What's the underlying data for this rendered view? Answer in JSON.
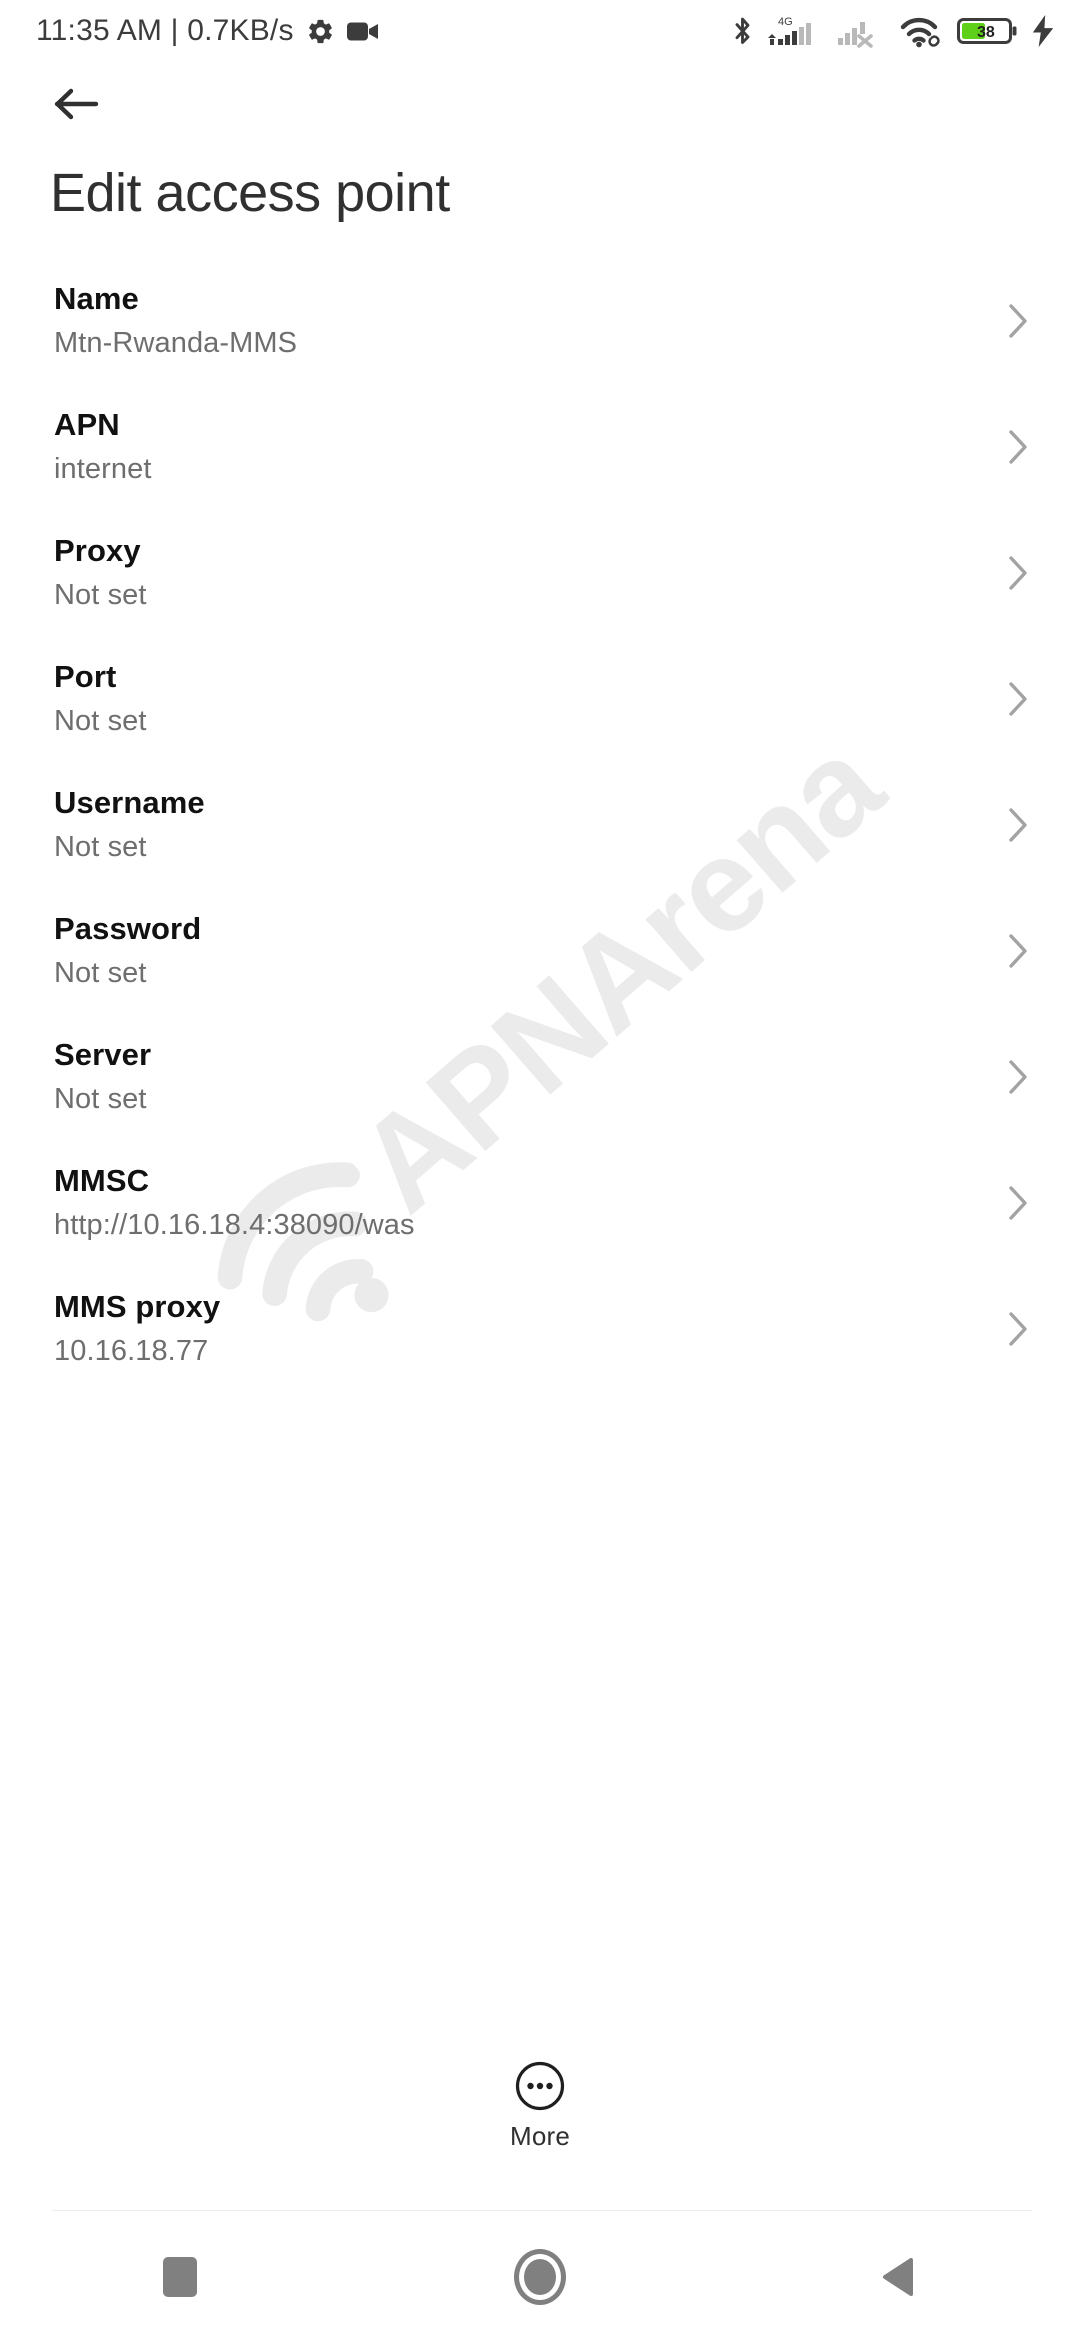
{
  "status_bar": {
    "clock_text": "11:35 AM | 0.7KB/s",
    "icons": [
      {
        "name": "gear-icon",
        "label": "Settings"
      },
      {
        "name": "video-camera-icon",
        "label": "Screen recorder"
      },
      {
        "name": "bluetooth-icon",
        "label": "Bluetooth"
      },
      {
        "name": "signal-4g-icon",
        "label": "4G"
      },
      {
        "name": "signal-sim2-no-service-icon",
        "label": "SIM 2 no service"
      },
      {
        "name": "wifi-icon",
        "label": "Wi-Fi connected"
      },
      {
        "name": "battery-icon",
        "label": "Battery"
      },
      {
        "name": "charging-bolt-icon",
        "label": "Charging"
      }
    ],
    "network_type": "4G",
    "battery_percent": "38",
    "colors": {
      "icon": "#3c3c3c",
      "icon_dim": "#b9b9b9",
      "battery_fill": "#5fd01a"
    }
  },
  "header": {
    "back_icon": "arrow-left-icon",
    "title": "Edit access point"
  },
  "settings": {
    "chevron_icon": "chevron-right-icon",
    "rows": [
      {
        "title": "Name",
        "value": "Mtn-Rwanda-MMS"
      },
      {
        "title": "APN",
        "value": "internet"
      },
      {
        "title": "Proxy",
        "value": "Not set"
      },
      {
        "title": "Port",
        "value": "Not set"
      },
      {
        "title": "Username",
        "value": "Not set"
      },
      {
        "title": "Password",
        "value": "Not set"
      },
      {
        "title": "Server",
        "value": "Not set"
      },
      {
        "title": "MMSC",
        "value": "http://10.16.18.4:38090/was"
      },
      {
        "title": "MMS proxy",
        "value": "10.16.18.77"
      }
    ]
  },
  "more_button": {
    "icon": "more-circle-icon",
    "label": "More"
  },
  "watermark": {
    "text": "APNArena",
    "color": "#ebebeb"
  },
  "nav_bar": {
    "recents_label": "Recents",
    "home_label": "Home",
    "back_label": "Back",
    "color": "#808080"
  }
}
